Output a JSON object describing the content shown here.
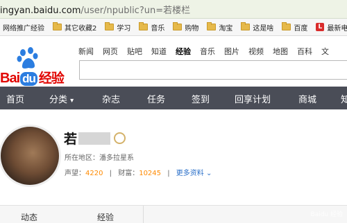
{
  "address_bar": {
    "host": "ingyan.baidu.com",
    "path": "/user/npublic?un=若楼栏"
  },
  "bookmarks": [
    {
      "label": "网络推广经验",
      "icon": "none"
    },
    {
      "label": "其它收藏2",
      "icon": "folder-icon"
    },
    {
      "label": "学习",
      "icon": "folder-icon"
    },
    {
      "label": "音乐",
      "icon": "folder-icon"
    },
    {
      "label": "购物",
      "icon": "folder-icon"
    },
    {
      "label": "淘宝",
      "icon": "folder-icon"
    },
    {
      "label": "这是啥",
      "icon": "folder-icon"
    },
    {
      "label": "百度",
      "icon": "folder-icon"
    },
    {
      "label": "最新电影",
      "icon": "red-l-icon",
      "icon_text": "L"
    }
  ],
  "logo": {
    "bai": "Bai",
    "du": "du",
    "jingyan": "经验"
  },
  "top_nav": [
    "新闻",
    "网页",
    "贴吧",
    "知道",
    "经验",
    "音乐",
    "图片",
    "视频",
    "地图",
    "百科",
    "文"
  ],
  "top_nav_active": "经验",
  "main_nav": [
    {
      "label": "首页"
    },
    {
      "label": "分类"
    },
    {
      "label": "杂志"
    },
    {
      "label": "任务"
    },
    {
      "label": "签到"
    },
    {
      "label": "回享计划"
    },
    {
      "label": "商城"
    },
    {
      "label": "知"
    }
  ],
  "main_nav_chevron": "▾",
  "profile": {
    "name_visible": "若",
    "location_label": "所在地区：",
    "location_value": "潘多拉星系",
    "prestige_label": "声望：",
    "prestige_value": "4220",
    "wealth_label": "财富：",
    "wealth_value": "10245",
    "more_info": "更多资料",
    "more_chevron": "⌄"
  },
  "tabs": [
    {
      "label": "动态"
    },
    {
      "label": "经验"
    }
  ],
  "watermark": "Baidu 经验"
}
